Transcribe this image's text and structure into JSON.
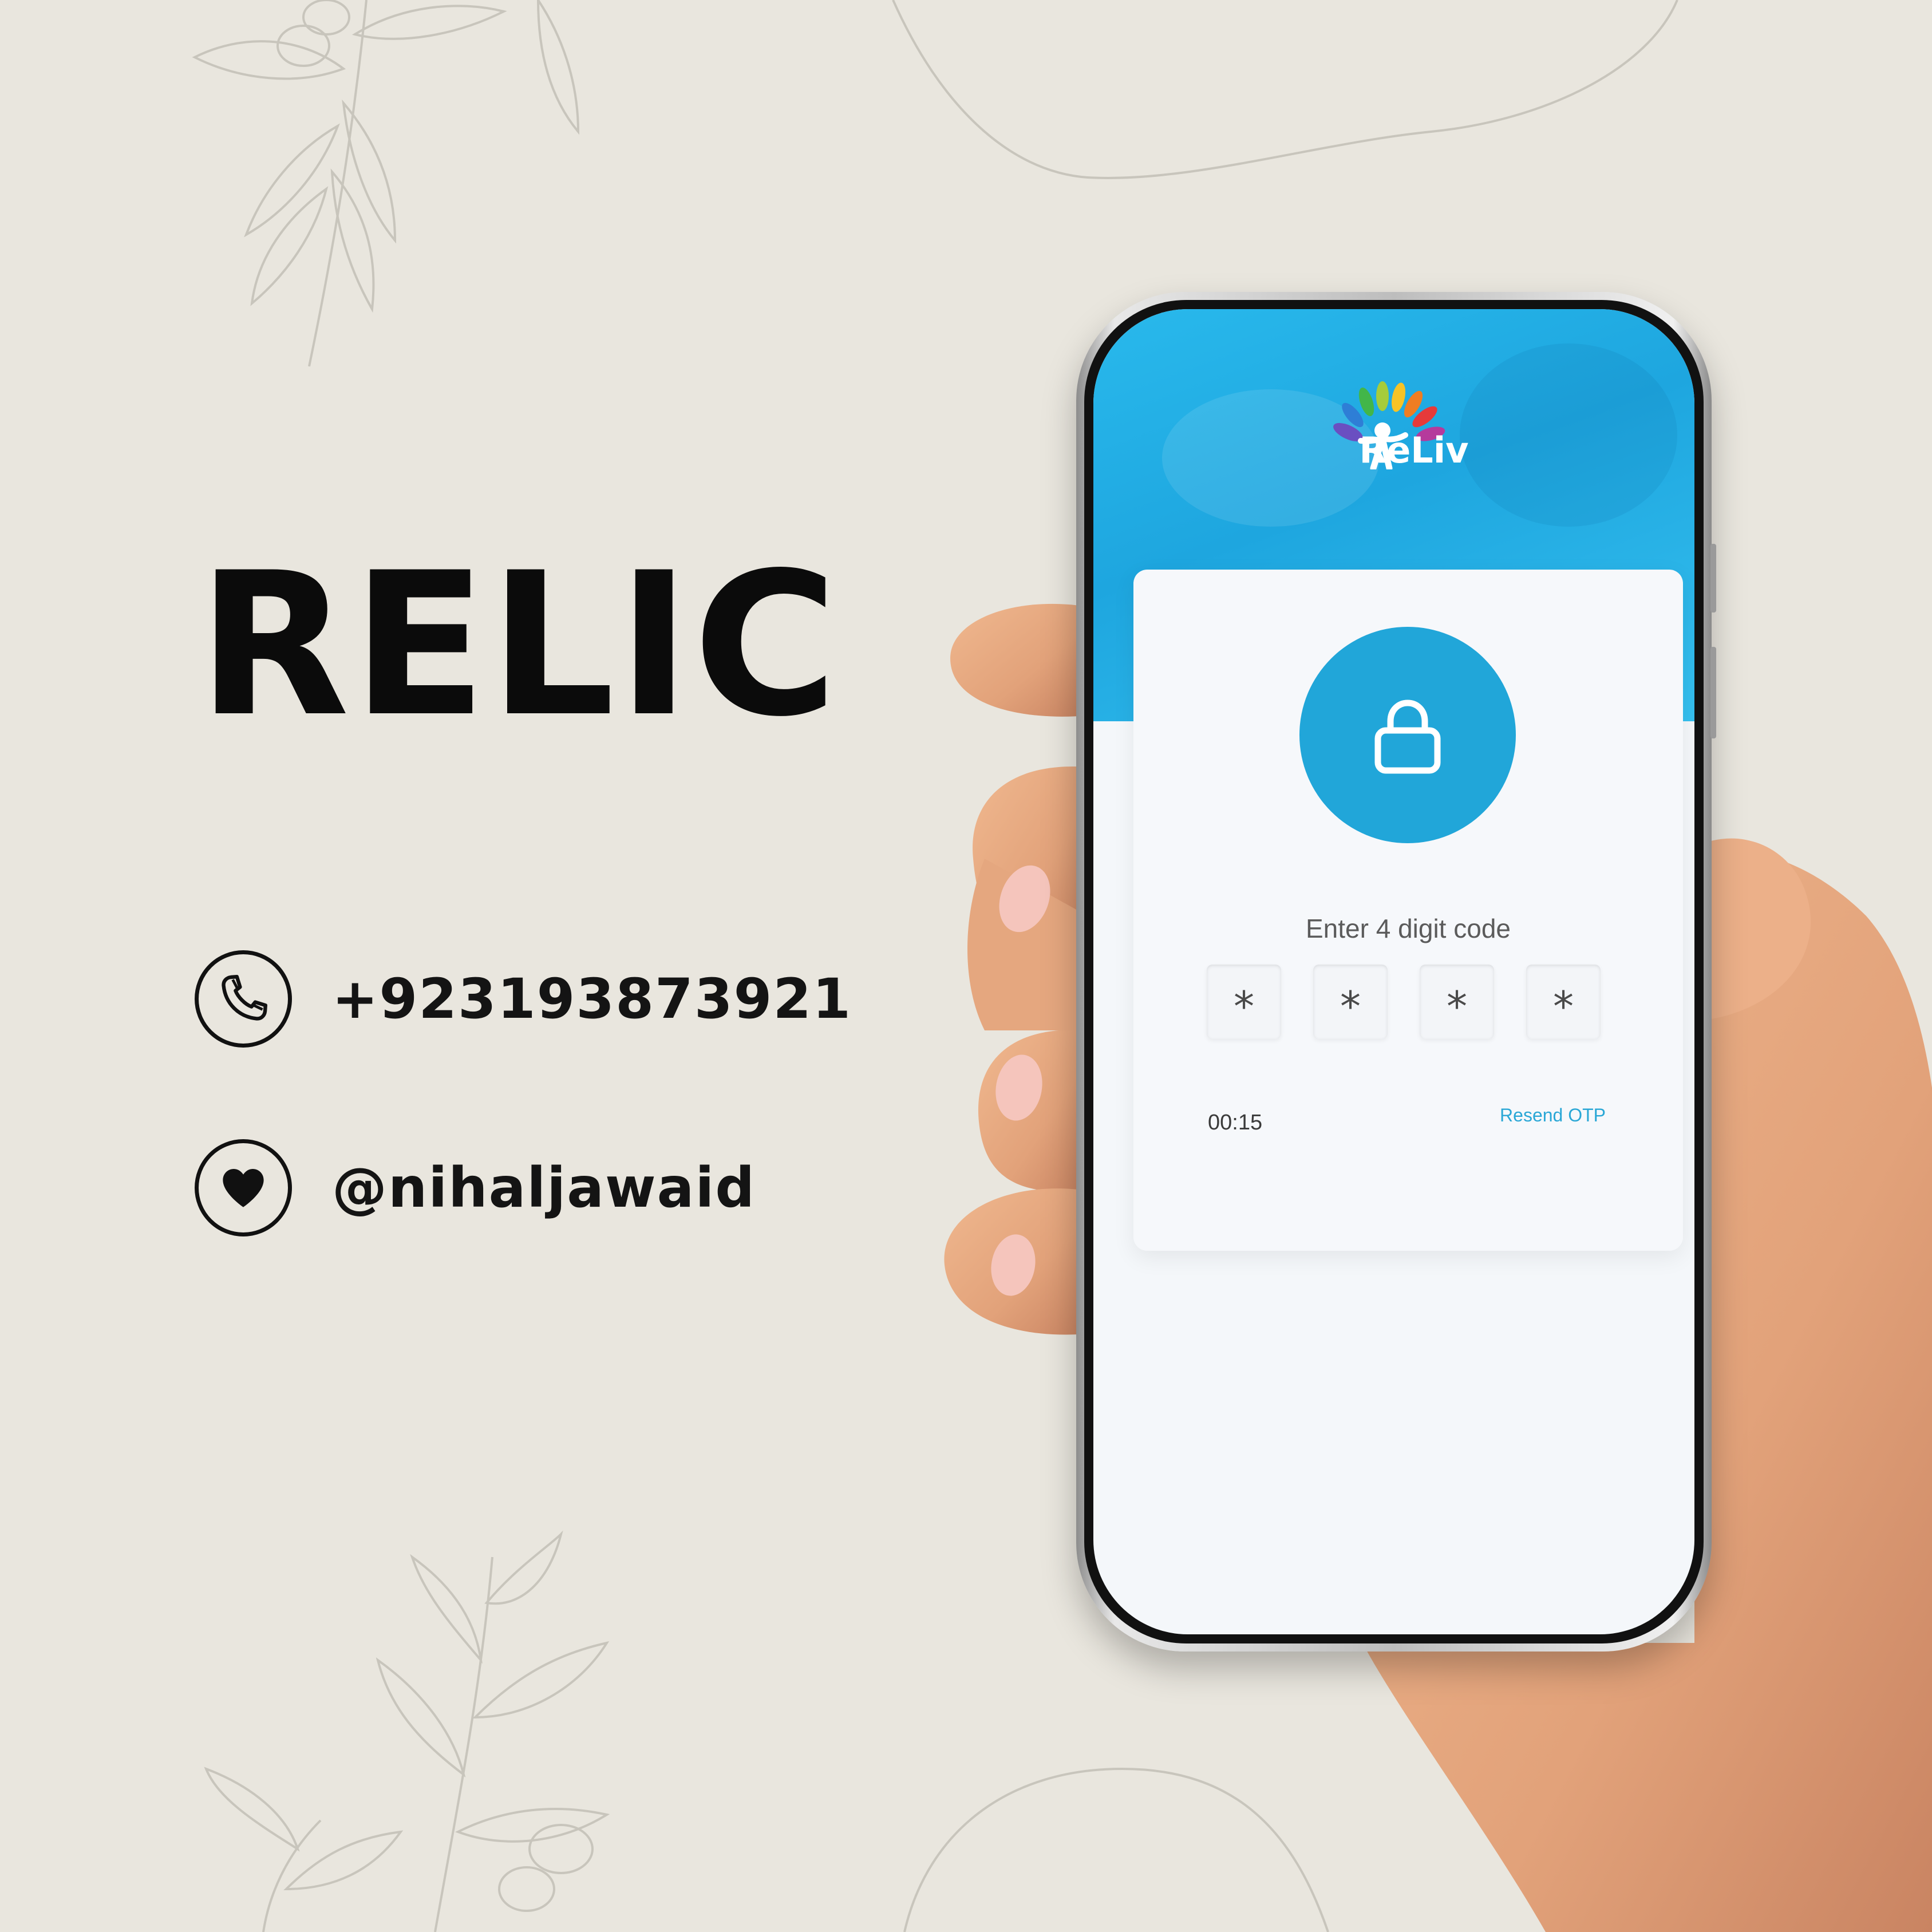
{
  "poster": {
    "title": "RELIC",
    "phone_number": "+923193873921",
    "handle": "@nihaljawaid",
    "phone_icon": "phone-icon",
    "heart_icon": "heart-icon"
  },
  "app": {
    "logo_text": "ReLiv",
    "lock_icon": "lock-icon",
    "prompt": "Enter 4 digit code",
    "otp_digits": [
      "*",
      "*",
      "*",
      "*"
    ],
    "timer": "00:15",
    "resend_label": "Resend OTP",
    "accent_color": "#21a6d9",
    "header_color": "#29b9ec"
  }
}
